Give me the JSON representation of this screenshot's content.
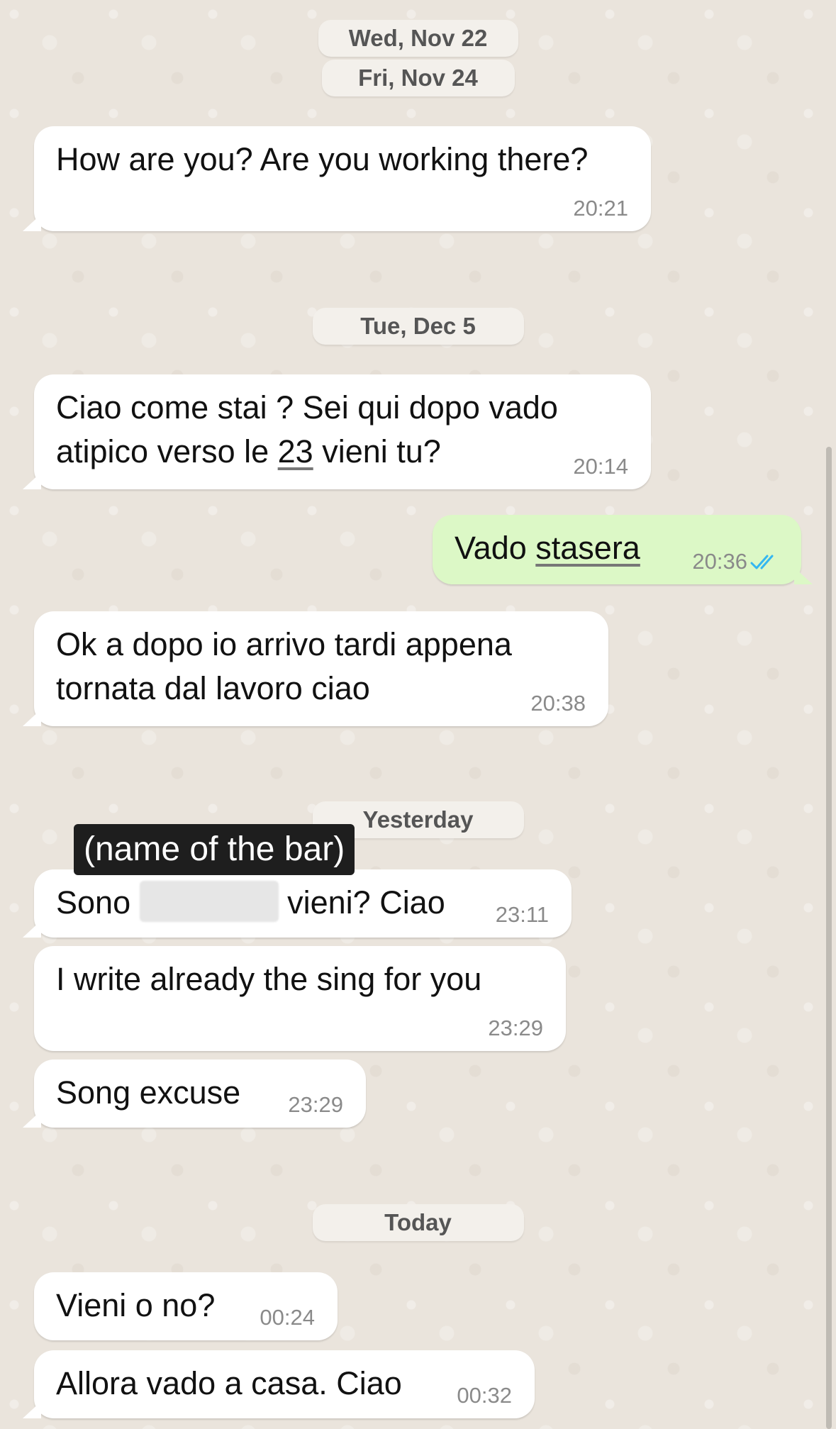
{
  "dates": {
    "wed_nov22": "Wed, Nov 22",
    "fri_nov24": "Fri, Nov 24",
    "tue_dec5": "Tue, Dec 5",
    "yesterday": "Yesterday",
    "today": "Today"
  },
  "messages": {
    "m1": {
      "text": "How are you? Are you working there?",
      "time": "20:21"
    },
    "m2": {
      "line1": "Ciao come stai ? Sei qui dopo vado",
      "line2_a": "atipico verso le ",
      "line2_link": "23",
      "line2_b": " vieni tu?",
      "time": "20:14"
    },
    "m3": {
      "text_a": "Vado ",
      "text_link": "stasera",
      "time": "20:36"
    },
    "m4": {
      "line1": "Ok a dopo io arrivo tardi appena",
      "line2": "tornata dal lavoro ciao",
      "time": "20:38"
    },
    "m5": {
      "text_a": "Sono ",
      "text_b": " vieni? Ciao",
      "time": "23:11"
    },
    "m6": {
      "text": "I write already the sing for you",
      "time": "23:29"
    },
    "m7": {
      "text": "Song excuse",
      "time": "23:29"
    },
    "m8": {
      "text": "Vieni o no?",
      "time": "00:24"
    },
    "m9": {
      "text": "Allora vado a casa. Ciao",
      "time": "00:32"
    }
  },
  "annotation": "(name of the bar)",
  "colors": {
    "incoming_bubble": "#FFFFFF",
    "outgoing_bubble": "#DCF8C6",
    "read_tick": "#34B7F1",
    "background": "#ECE5DD"
  },
  "icons": {
    "read_receipt": "double-check-icon"
  }
}
